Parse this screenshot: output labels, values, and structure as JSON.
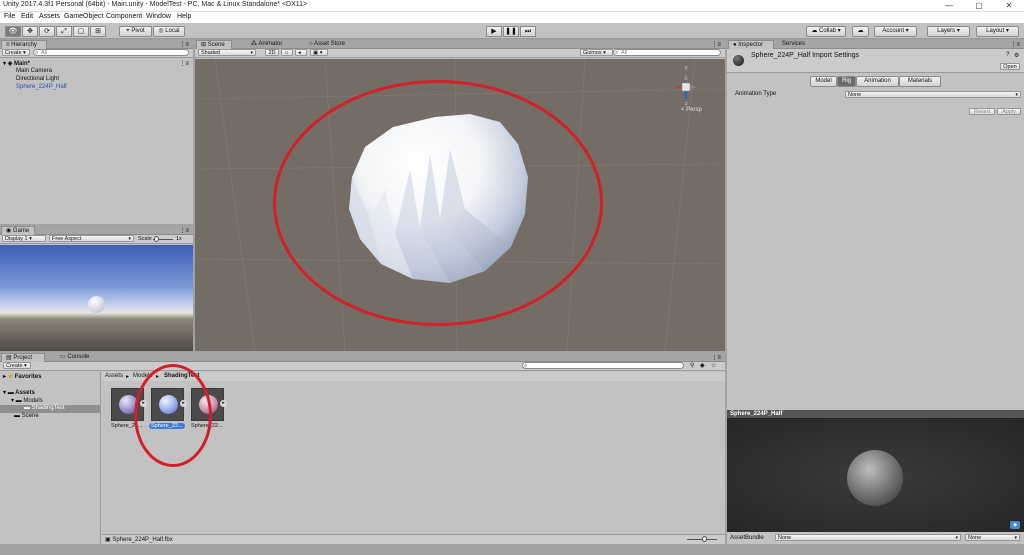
{
  "window": {
    "title": "Unity 2017.4.3f1 Personal (64bit) - Main.unity - ModelTest - PC, Mac & Linux Standalone* <DX11>",
    "controls": [
      "—",
      "▢",
      "✕"
    ]
  },
  "menu": [
    "File",
    "Edit",
    "Assets",
    "GameObject",
    "Component",
    "Window",
    "Help"
  ],
  "toolbar": {
    "pivot": "Pivot",
    "local": "Local",
    "collab": "Collab",
    "account": "Account",
    "layers": "Layers",
    "layout": "Layout"
  },
  "hierarchy": {
    "tab": "Hierarchy",
    "create": "Create",
    "search_placeholder": "All",
    "scene": "Main*",
    "items": [
      "Main Camera",
      "Directional Light",
      "Sphere_224P_Half"
    ]
  },
  "scene": {
    "tabs": [
      "Scene",
      "Animator",
      "Asset Store"
    ],
    "shading": "Shaded",
    "mode2d": "2D",
    "gizmos": "Gizmos",
    "search_placeholder": "All",
    "persp": "< Persp",
    "axis_y": "y",
    "axis_z": "z"
  },
  "game": {
    "tab": "Game",
    "display": "Display 1",
    "aspect": "Free Aspect",
    "scale_label": "Scale",
    "scale_value": "1x"
  },
  "project": {
    "tabs": [
      "Project",
      "Console"
    ],
    "create": "Create",
    "favorites": "Favorites",
    "assets": "Assets",
    "tree": [
      "Models",
      "ShadingTest",
      "Scene"
    ],
    "breadcrumb": [
      "Assets",
      "Models",
      "ShadingTest"
    ],
    "thumbnails": [
      "Sphere_22...",
      "Sphere_22...",
      "Sphere_22..."
    ],
    "selected_index": 1,
    "status_file": "Sphere_224P_Half.fbx"
  },
  "inspector": {
    "tabs": [
      "Inspector",
      "Services"
    ],
    "title": "Sphere_224P_Half Import Settings",
    "open": "Open",
    "subtabs": [
      "Model",
      "Rig",
      "Animation",
      "Materials"
    ],
    "selected_subtab": "Rig",
    "animation_type_label": "Animation Type",
    "animation_type_value": "None",
    "revert": "Revert",
    "apply": "Apply"
  },
  "preview": {
    "title": "Sphere_224P_Half",
    "assetbundle_label": "AssetBundle",
    "bundle_value": "None",
    "variant_value": "None"
  },
  "colors": {
    "annotation": "#d41f26",
    "selection": "#3e7bd6",
    "scene_bg": "#736d66"
  }
}
